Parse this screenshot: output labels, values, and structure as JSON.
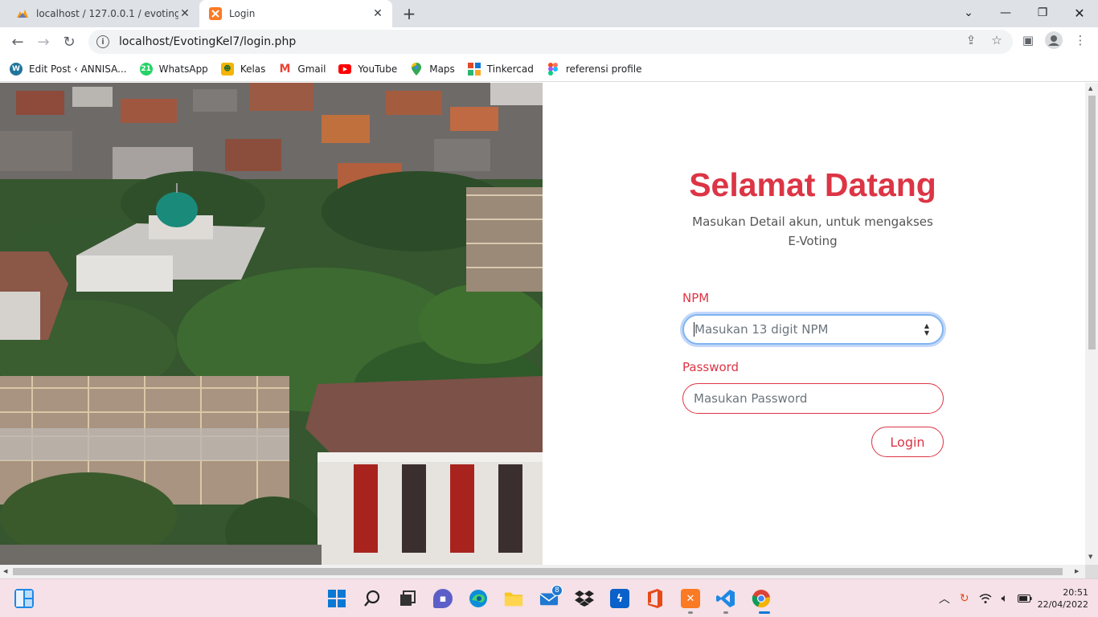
{
  "browser": {
    "tabs": [
      {
        "title": "localhost / 127.0.0.1 / evoting / p",
        "icon": "phpmyadmin-icon",
        "active": false
      },
      {
        "title": "Login",
        "icon": "xampp-icon",
        "active": true
      }
    ],
    "url": "localhost/EvotingKel7/login.php",
    "bookmarks": [
      {
        "label": "Edit Post ‹ ANNISA...",
        "icon": "wordpress-icon",
        "color": "#21759b"
      },
      {
        "label": "WhatsApp",
        "icon": "whatsapp-icon",
        "color": "#25d366"
      },
      {
        "label": "Kelas",
        "icon": "google-classroom-icon",
        "color": "#f4b400"
      },
      {
        "label": "Gmail",
        "icon": "gmail-icon",
        "color": "#ea4335"
      },
      {
        "label": "YouTube",
        "icon": "youtube-icon",
        "color": "#ff0000"
      },
      {
        "label": "Maps",
        "icon": "maps-pin-icon",
        "color": "#34a853"
      },
      {
        "label": "Tinkercad",
        "icon": "tinkercad-icon",
        "color": "#e04b2a"
      },
      {
        "label": "referensi profile",
        "icon": "figma-icon",
        "color": "#f24e1e"
      }
    ]
  },
  "login": {
    "title": "Selamat Datang",
    "subtitle": "Masukan Detail akun, untuk mengakses E-Voting",
    "npm_label": "NPM",
    "npm_placeholder": "Masukan 13 digit NPM",
    "password_label": "Password",
    "password_placeholder": "Masukan Password",
    "login_button": "Login"
  },
  "taskbar": {
    "apps": [
      "start-icon",
      "search-icon",
      "task-view-icon",
      "chat-icon",
      "edge-icon",
      "file-explorer-icon",
      "mail-icon",
      "dropbox-icon",
      "powershell-icon",
      "office-icon",
      "xampp-icon",
      "vscode-icon",
      "chrome-icon"
    ],
    "mail_badge": "8",
    "time": "20:51",
    "date": "22/04/2022"
  },
  "colors": {
    "accent": "#dc3545",
    "focus_ring": "#80b5f0"
  }
}
